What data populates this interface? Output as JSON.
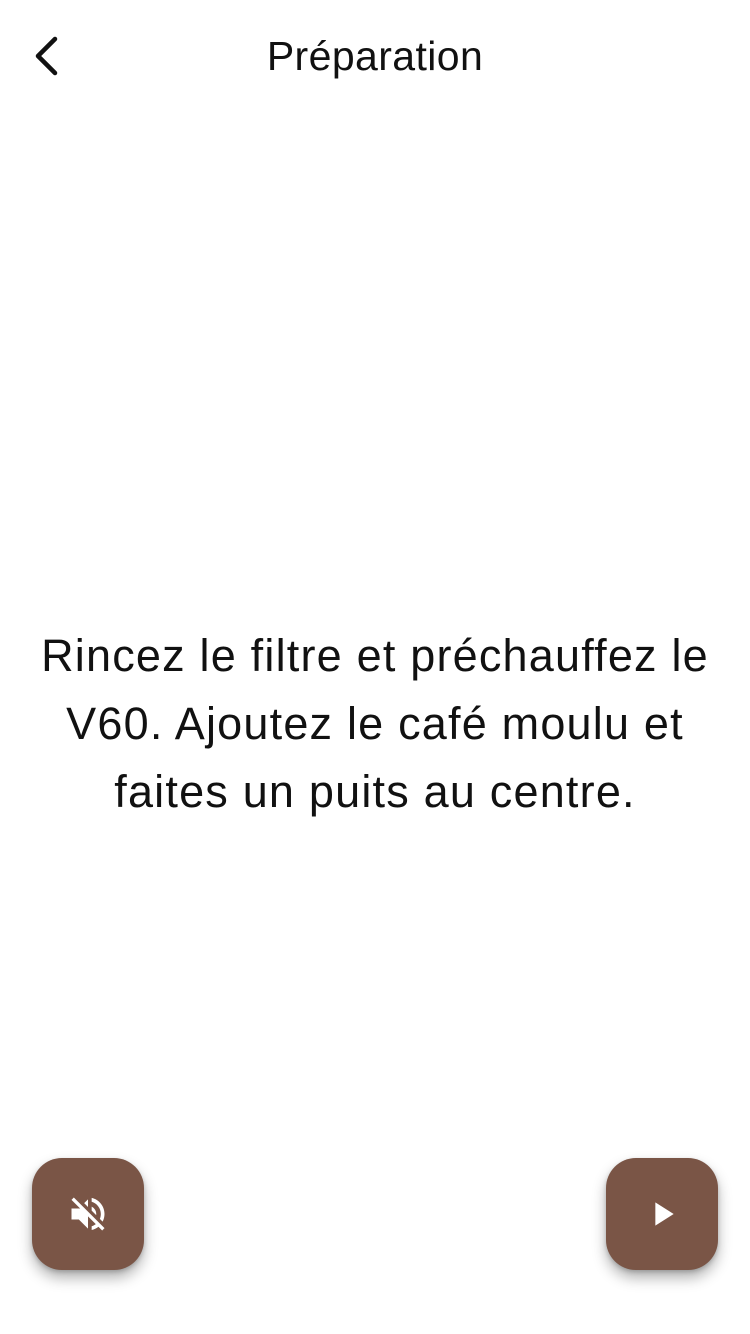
{
  "header": {
    "title": "Préparation",
    "back_icon": "chevron-left-icon"
  },
  "main": {
    "instruction": "Rincez le filtre et préchauffez le V60. Ajoutez le café moulu et faites un puits au centre."
  },
  "controls": {
    "sound_icon": "volume-off-icon",
    "play_icon": "play-icon"
  },
  "colors": {
    "button_background": "#7a5546",
    "icon": "#ffffff",
    "text": "#111111",
    "background": "#ffffff"
  }
}
